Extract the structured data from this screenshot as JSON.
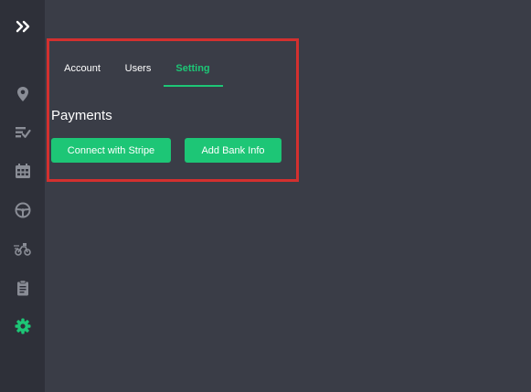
{
  "sidebar": {
    "items": [
      {
        "icon": "expand-chevrons-icon"
      },
      {
        "icon": "location-pin-icon"
      },
      {
        "icon": "checklist-icon"
      },
      {
        "icon": "calendar-icon"
      },
      {
        "icon": "steering-wheel-icon"
      },
      {
        "icon": "delivery-bike-icon"
      },
      {
        "icon": "clipboard-icon"
      },
      {
        "icon": "settings-gear-icon",
        "active": true
      }
    ]
  },
  "tabs": {
    "account": "Account",
    "users": "Users",
    "setting": "Setting",
    "active": "Setting"
  },
  "payments": {
    "title": "Payments",
    "connect_stripe_label": "Connect with Stripe",
    "add_bank_label": "Add Bank Info"
  },
  "colors": {
    "accent": "#1dc676",
    "highlight": "#d3302f",
    "background": "#3a3d47",
    "sidebar": "#2e3039"
  }
}
